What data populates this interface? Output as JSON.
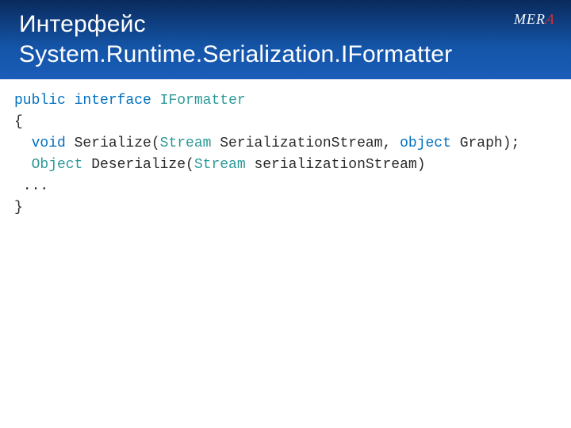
{
  "header": {
    "title_line1": "Интерфейс",
    "title_line2": "System.Runtime.Serialization.IFormatter",
    "logo_text": "MER",
    "logo_accent": "A"
  },
  "code": {
    "l1_kw1": "public",
    "l1_kw2": "interface",
    "l1_type": "IFormatter",
    "l2": "{",
    "l3_kw": "void",
    "l3_name": " Serialize(",
    "l3_type1": "Stream",
    "l3_mid": " SerializationStream, ",
    "l3_kw2": "object",
    "l3_end": " Graph);",
    "l4_type1": "Object",
    "l4_name": " Deserialize(",
    "l4_type2": "Stream",
    "l4_end": " serializationStream)",
    "l5": "...",
    "l6": "}"
  }
}
